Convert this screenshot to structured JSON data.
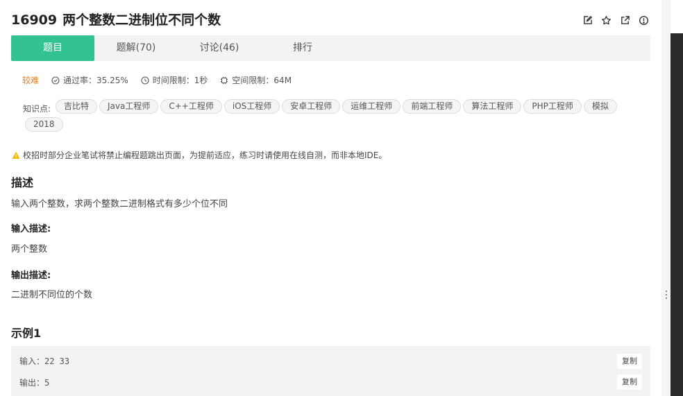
{
  "problem": {
    "id": "16909",
    "title": "两个整数二进制位不同个数"
  },
  "tabs": [
    {
      "label": "题目"
    },
    {
      "label": "题解(70)"
    },
    {
      "label": "讨论(46)"
    },
    {
      "label": "排行"
    }
  ],
  "meta": {
    "difficulty": "较难",
    "pass_rate": "通过率：35.25%",
    "time_limit": "时间限制：1秒",
    "space_limit": "空间限制：64M"
  },
  "knowledge": {
    "label": "知识点:",
    "tags": [
      "吉比特",
      "Java工程师",
      "C++工程师",
      "iOS工程师",
      "安卓工程师",
      "运维工程师",
      "前端工程师",
      "算法工程师",
      "PHP工程师",
      "模拟",
      "2018"
    ]
  },
  "notice": "校招时部分企业笔试将禁止编程题跳出页面，为提前适应，练习时请使用在线自测，而非本地IDE。",
  "description": {
    "heading": "描述",
    "text": "输入两个整数，求两个整数二进制格式有多少个位不同"
  },
  "input_desc": {
    "heading": "输入描述:",
    "text": "两个整数"
  },
  "output_desc": {
    "heading": "输出描述:",
    "text": "二进制不同位的个数"
  },
  "example": {
    "heading": "示例1",
    "input": "输入：22 33",
    "output": "输出：5",
    "copy_label": "复制"
  },
  "colors": {
    "accent": "#32c391",
    "difficulty": "#e0802d",
    "warning": "#f5b800"
  }
}
